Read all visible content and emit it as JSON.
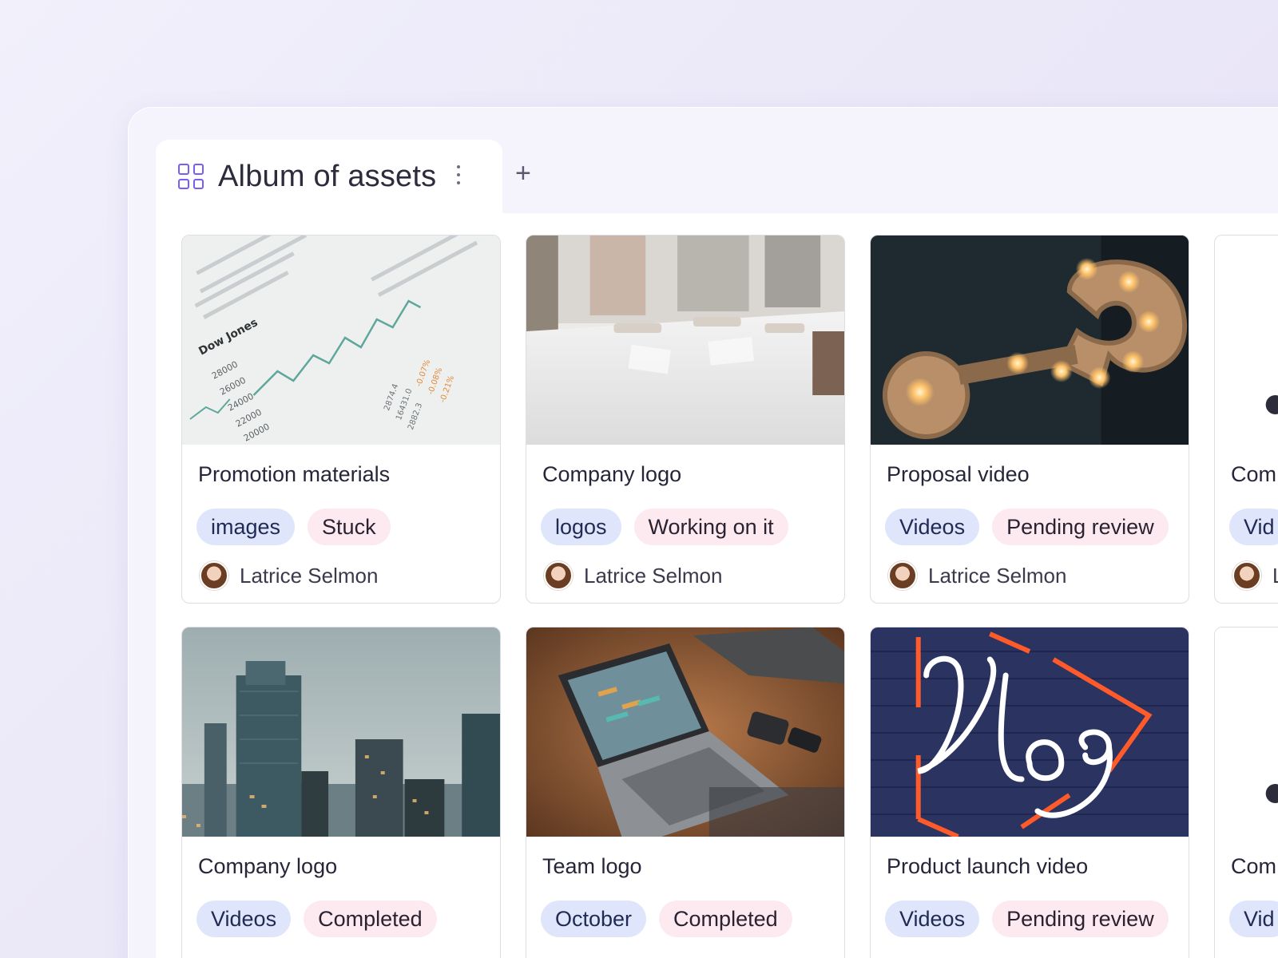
{
  "board": {
    "tab_title": "Album of assets",
    "tab_icon": "grid-icon",
    "tab_menu_icon": "kebab-icon",
    "add_tab_label": "+"
  },
  "colors": {
    "accent": "#7d5cf0",
    "category_tag_bg": "#dfe6fb",
    "status_tag_bg": "#fdeaf1"
  },
  "cards": [
    {
      "title": "Promotion materials",
      "category": "images",
      "status": "Stuck",
      "owner": "Latrice Selmon",
      "image": "stock-chart-newspaper"
    },
    {
      "title": "Company logo",
      "category": "logos",
      "status": "Working on it",
      "owner": "Latrice Selmon",
      "image": "team-meeting-table"
    },
    {
      "title": "Proposal video",
      "category": "Videos",
      "status": "Pending review",
      "owner": "Latrice Selmon",
      "image": "marquee-question-mark"
    },
    {
      "title": "Com",
      "category": "Vid",
      "status": "",
      "owner": "L",
      "image": "partial"
    },
    {
      "title": "Company logo",
      "category": "Videos",
      "status": "Completed",
      "owner": "",
      "image": "city-skyline"
    },
    {
      "title": "Team logo",
      "category": "October",
      "status": "Completed",
      "owner": "",
      "image": "laptop-on-leather"
    },
    {
      "title": "Product launch video",
      "category": "Videos",
      "status": "Pending review",
      "owner": "",
      "image": "neon-vlog-sign"
    },
    {
      "title": "Com",
      "category": "Vid",
      "status": "",
      "owner": "",
      "image": "partial"
    }
  ]
}
